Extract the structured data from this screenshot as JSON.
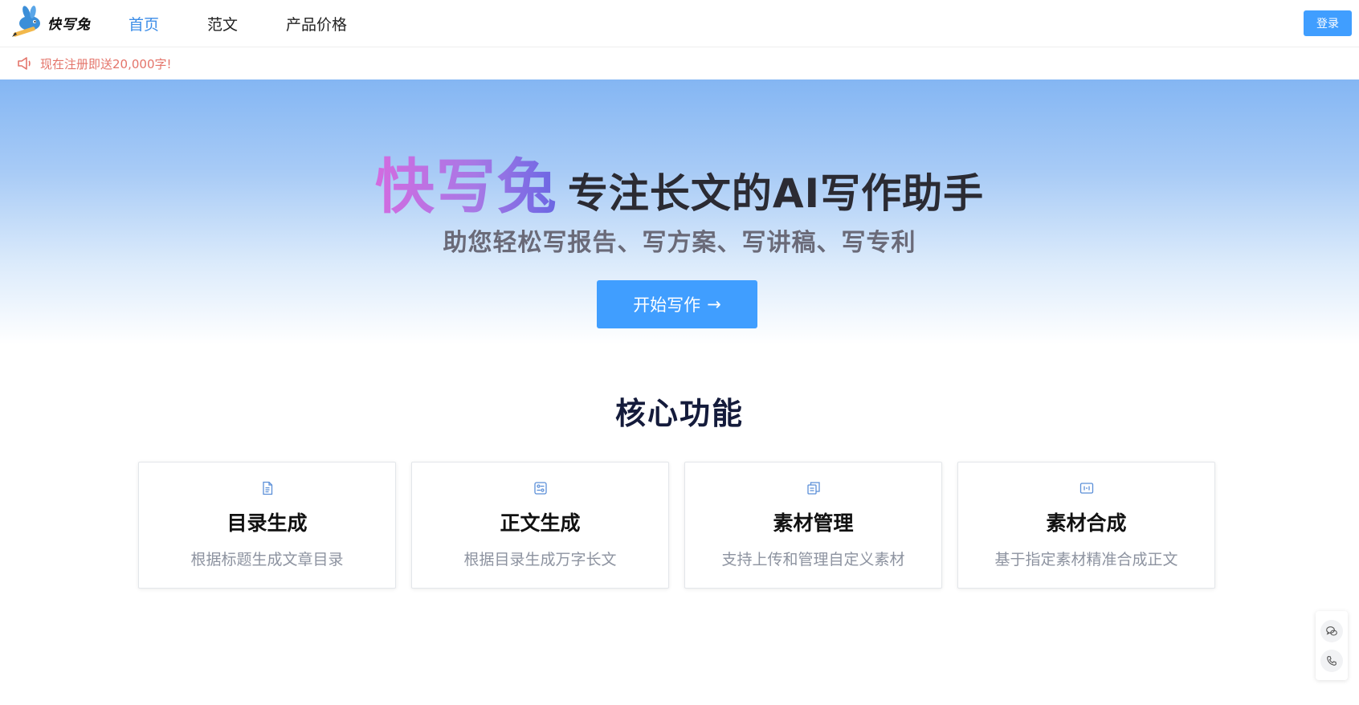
{
  "header": {
    "logo_text": "快写兔",
    "nav": [
      {
        "label": "首页",
        "active": true
      },
      {
        "label": "范文",
        "active": false
      },
      {
        "label": "产品价格",
        "active": false
      }
    ],
    "login_label": "登录"
  },
  "notice": {
    "icon": "speaker-icon",
    "text": "现在注册即送20,000字!"
  },
  "hero": {
    "brand": "快写兔",
    "slogan": "专注长文的AI写作助手",
    "subtitle": "助您轻松写报告、写方案、写讲稿、写专利",
    "start_label": "开始写作",
    "start_arrow": "→"
  },
  "features": {
    "title": "核心功能",
    "cards": [
      {
        "icon": "document-icon",
        "title": "目录生成",
        "desc": "根据标题生成文章目录"
      },
      {
        "icon": "settings-panel-icon",
        "title": "正文生成",
        "desc": "根据目录生成万字长文"
      },
      {
        "icon": "copy-document-icon",
        "title": "素材管理",
        "desc": "支持上传和管理自定义素材"
      },
      {
        "icon": "merge-icon",
        "title": "素材合成",
        "desc": "基于指定素材精准合成正文"
      }
    ]
  },
  "float_bar": {
    "items": [
      "wechat-icon",
      "phone-icon"
    ]
  },
  "colors": {
    "accent": "#409eff",
    "notice": "#e4746a",
    "icon": "#5b8fd8"
  }
}
